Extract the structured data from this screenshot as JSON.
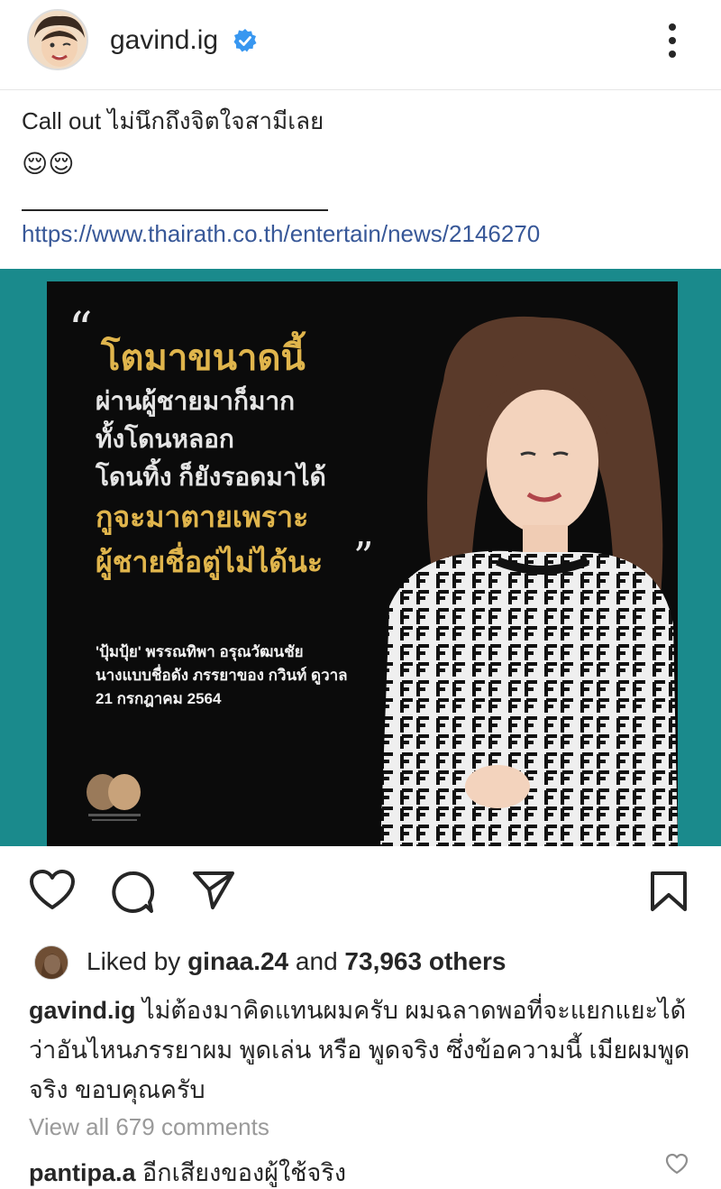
{
  "header": {
    "username": "gavind.ig",
    "verified": true,
    "menu_icon": "more-vertical-icon"
  },
  "post": {
    "text": "Call out ไม่นึกถึงจิตใจสามีเลย",
    "emoji": "😌😌",
    "link": "https://www.thairath.co.th/entertain/news/2146270"
  },
  "photo": {
    "quote_open": "“",
    "quote_close": "”",
    "line_1": "โตมาขนาดนี้",
    "lines_2": [
      "ผ่านผู้ชายมาก็มาก",
      "ทั้งโดนหลอก",
      "โดนทิ้ง ก็ยังรอดมาได้"
    ],
    "lines_3": [
      "กูจะมาตายเพราะ",
      "ผู้ชายชื่อตู่ไม่ได้นะ"
    ],
    "attribution": [
      "'ปุ้มปุ้ย' พรรณทิพา อรุณวัฒนชัย",
      "นางแบบชื่อดัง ภรรยาของ กวินท์ ดูวาล",
      "21 กรกฎาคม 2564"
    ],
    "bg_color": "#1a8a8c",
    "gold_color": "#e0b54c"
  },
  "actions": {
    "like_icon": "heart-icon",
    "comment_icon": "comment-icon",
    "share_icon": "send-icon",
    "save_icon": "bookmark-icon"
  },
  "likes": {
    "prefix": "Liked by ",
    "user": "ginaa.24",
    "middle": " and ",
    "count": "73,963 others"
  },
  "caption": {
    "username": "gavind.ig",
    "text": " ไม่ต้องมาคิดแทนผมครับ ผมฉลาดพอที่จะแยกแยะได้ว่าอันไหนภรรยาผม พูดเล่น หรือ พูดจริง ซึ่งข้อความนี้ เมียผมพูดจริง ขอบคุณครับ"
  },
  "comments": {
    "view_all": "View all 679 comments",
    "first": {
      "username": "pantipa.a",
      "text": " อีกเสียงของผู้ใช้จริง"
    }
  }
}
